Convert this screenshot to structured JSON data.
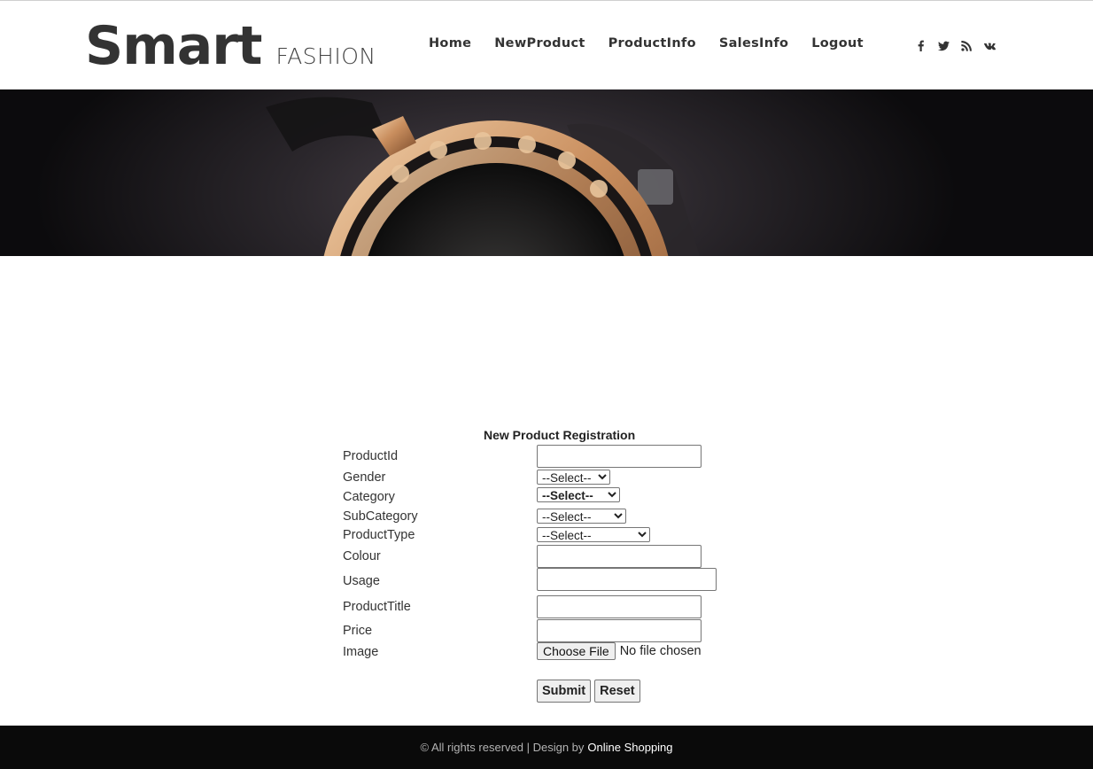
{
  "brand": {
    "name": "Smart",
    "tagline": "FASHION"
  },
  "nav": [
    "Home",
    "NewProduct",
    "ProductInfo",
    "SalesInfo",
    "Logout"
  ],
  "social": [
    "facebook-icon",
    "twitter-icon",
    "rss-icon",
    "vk-icon"
  ],
  "banner": {
    "description_icon": "watch-banner-image"
  },
  "form": {
    "title": "New Product Registration",
    "labels": {
      "product_id": "ProductId",
      "gender": "Gender",
      "category": "Category",
      "subcategory": "SubCategory",
      "product_type": "ProductType",
      "colour": "Colour",
      "usage": "Usage",
      "product_title": "ProductTitle",
      "price": "Price",
      "image": "Image"
    },
    "selects": {
      "gender": "--Select--",
      "category": "--Select--",
      "subcategory": "--Select--",
      "product_type": "--Select--"
    },
    "file": {
      "button": "Choose File",
      "status": "No file chosen"
    },
    "buttons": {
      "submit": "Submit",
      "reset": "Reset"
    }
  },
  "footer": {
    "text": "© All rights reserved | Design by",
    "link": "Online Shopping"
  },
  "colors": {
    "header_bg": "#ffffff",
    "footer_bg": "#0a0a0a",
    "text": "#333333"
  }
}
